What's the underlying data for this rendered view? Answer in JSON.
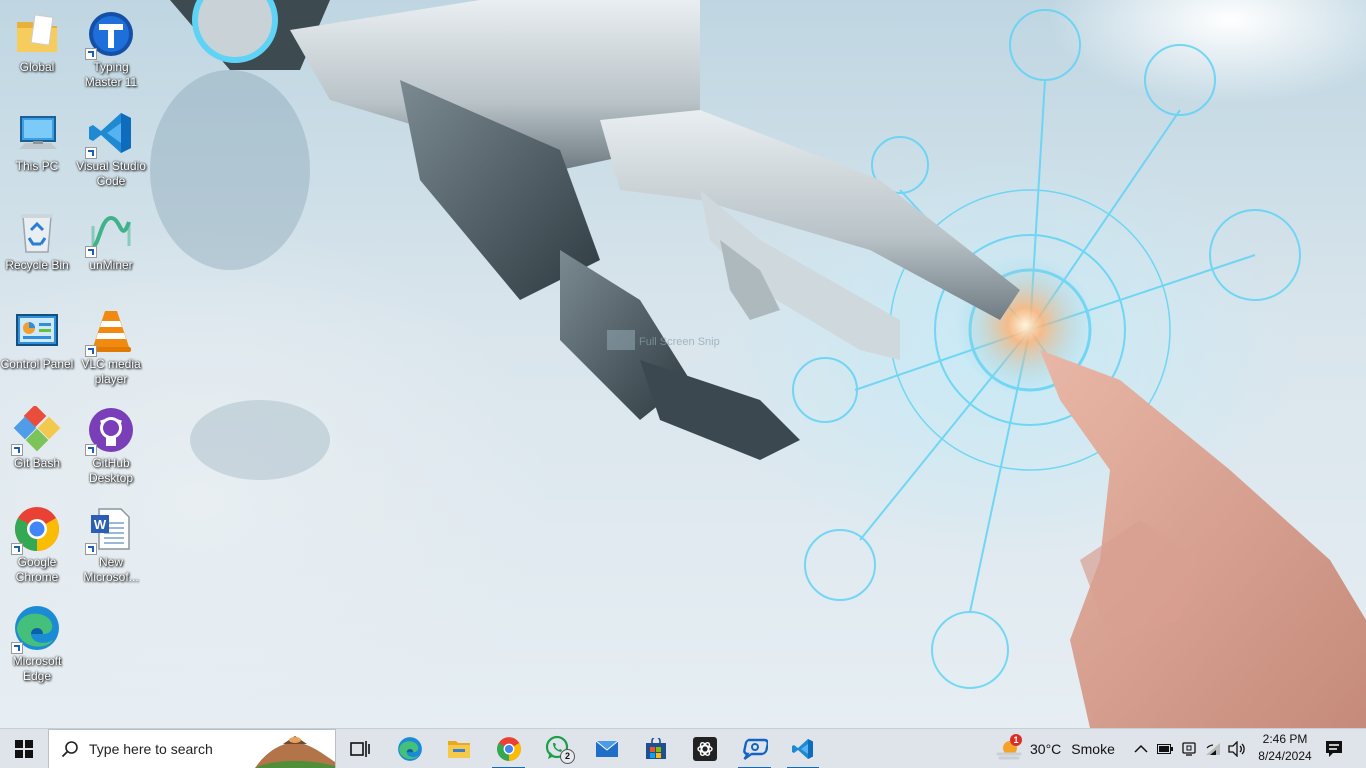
{
  "desktop": {
    "icons": [
      {
        "label": "Global"
      },
      {
        "label": "Typing Master 11"
      },
      {
        "label": "This PC"
      },
      {
        "label": "Visual Studio Code"
      },
      {
        "label": "Recycle Bin"
      },
      {
        "label": "unMiner"
      },
      {
        "label": "Control Panel"
      },
      {
        "label": "VLC media player"
      },
      {
        "label": "Git Bash"
      },
      {
        "label": "GitHub Desktop"
      },
      {
        "label": "Google Chrome"
      },
      {
        "label": "New Microsof..."
      },
      {
        "label": "Microsoft Edge"
      }
    ],
    "wallpaper_watermark": "Full Screen Snip"
  },
  "taskbar": {
    "search_placeholder": "Type here to search",
    "apps": [
      {
        "name": "task-view-icon"
      },
      {
        "name": "edge-icon"
      },
      {
        "name": "file-explorer-icon"
      },
      {
        "name": "chrome-icon",
        "active": true
      },
      {
        "name": "whatsapp-icon",
        "badge": "2"
      },
      {
        "name": "mail-icon"
      },
      {
        "name": "store-icon"
      },
      {
        "name": "chatgpt-icon"
      },
      {
        "name": "quick-assist-icon",
        "active": true
      },
      {
        "name": "vscode-icon",
        "active": true
      }
    ],
    "weather": {
      "temp": "30°C",
      "condition": "Smoke",
      "alert_badge": "1"
    },
    "clock": {
      "time": "2:46 PM",
      "date": "8/24/2024"
    }
  },
  "colors": {
    "accent": "#0f6cbd",
    "taskbar_bg": "#dfe4ea"
  }
}
